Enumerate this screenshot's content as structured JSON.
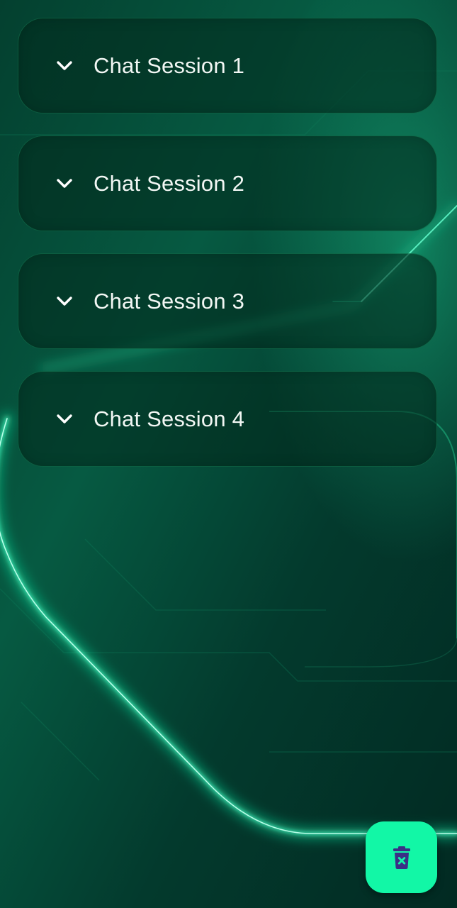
{
  "sessions": [
    {
      "label": "Chat Session 1",
      "icon": "chevron-down-icon"
    },
    {
      "label": "Chat Session 2",
      "icon": "chevron-down-icon"
    },
    {
      "label": "Chat Session 3",
      "icon": "chevron-down-icon"
    },
    {
      "label": "Chat Session 4",
      "icon": "chevron-down-icon"
    }
  ],
  "fab": {
    "icon": "trash-delete-icon"
  },
  "colors": {
    "background": "#03382c",
    "glow_line": "#31f5bb",
    "fab": "#12f7a6",
    "fab_icon": "#3a2f86",
    "text": "#f2f7f4"
  }
}
